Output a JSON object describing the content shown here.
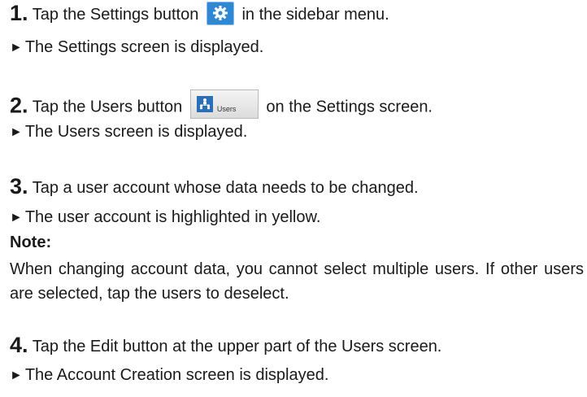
{
  "steps": [
    {
      "number": "1.",
      "text_before": "Tap the Settings button",
      "text_after": "in the sidebar menu.",
      "result": "The Settings screen is displayed."
    },
    {
      "number": "2.",
      "text_before": "Tap the Users button",
      "text_after": "on the Settings screen.",
      "button_label": "Users",
      "result": "The Users screen is displayed."
    },
    {
      "number": "3.",
      "text": "Tap a user account whose data needs to be changed.",
      "result": "The user account is highlighted in yellow.",
      "note_title": "Note:",
      "note_body": "When changing account data, you cannot select multiple users. If other users are selected, tap the users to deselect."
    },
    {
      "number": "4.",
      "text": "Tap the Edit button at the upper part of the Users screen.",
      "result": "The Account Creation screen is displayed."
    }
  ],
  "arrow_glyph": "►",
  "colors": {
    "settings_button": "#2f88d4",
    "users_icon": "#2a6fb8"
  },
  "icons": {
    "settings": "gear-icon",
    "users": "users-hierarchy-icon"
  }
}
